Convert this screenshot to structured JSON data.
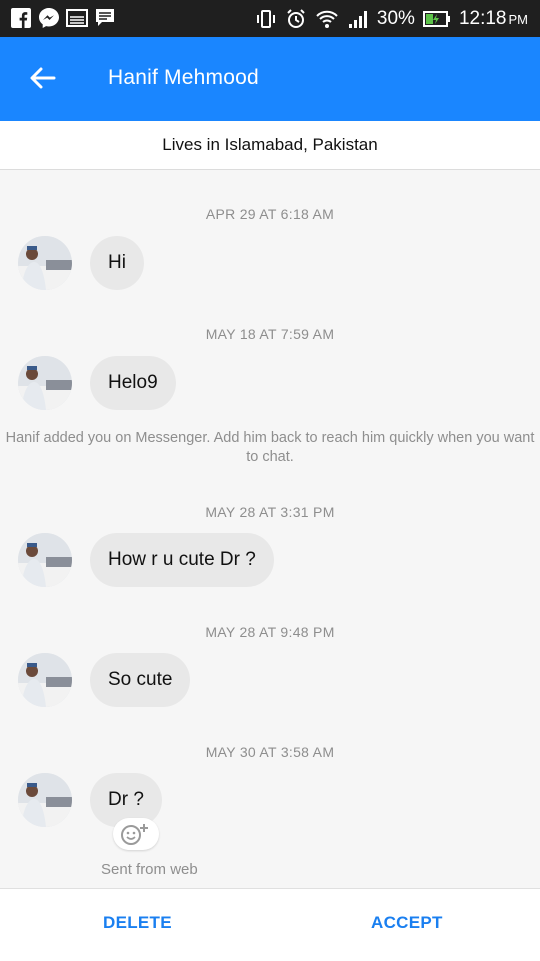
{
  "status_bar": {
    "battery": "30%",
    "time": "12:18",
    "ampm": "PM"
  },
  "header": {
    "title": "Hanif Mehmood"
  },
  "profile_info": "Lives in Islamabad, Pakistan",
  "messages": [
    {
      "timestamp": "APR 29 AT 6:18 AM",
      "text": "Hi"
    },
    {
      "timestamp": "MAY 18 AT 7:59 AM",
      "text": "Helo9"
    },
    {
      "timestamp": "MAY 28 AT 3:31 PM",
      "text": "How r u cute Dr ?"
    },
    {
      "timestamp": "MAY 28 AT 9:48 PM",
      "text": "So cute"
    },
    {
      "timestamp": "MAY 30 AT 3:58 AM",
      "text": "Dr ?"
    }
  ],
  "notice": "Hanif added you on Messenger. Add him back to reach him quickly when you want to chat.",
  "sent_from": "Sent from web",
  "actions": {
    "delete": "DELETE",
    "accept": "ACCEPT"
  },
  "colors": {
    "accent": "#1a86ff",
    "bubble": "#e8e8e8",
    "status_bar": "#1f1f1f",
    "action_text": "#1a7ff0"
  }
}
